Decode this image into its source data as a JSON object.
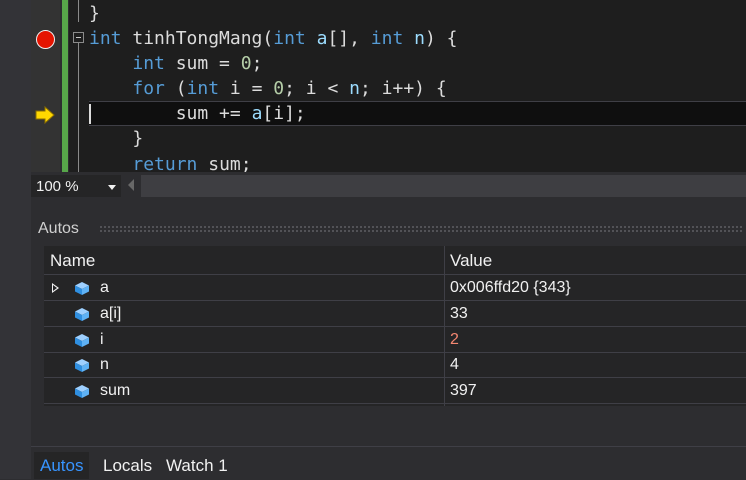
{
  "editor": {
    "lines": [
      {
        "tokens": [
          [
            "plain",
            "}"
          ]
        ]
      },
      {
        "tokens": [
          [
            "kw",
            "int"
          ],
          [
            "fn",
            " tinhTongMang("
          ],
          [
            "kw",
            "int"
          ],
          [
            "param",
            " a"
          ],
          [
            "plain",
            "[], "
          ],
          [
            "kw",
            "int"
          ],
          [
            "param",
            " n"
          ],
          [
            "plain",
            ") {"
          ]
        ]
      },
      {
        "tokens": [
          [
            "plain",
            "    "
          ],
          [
            "kw",
            "int"
          ],
          [
            "plain",
            " sum = "
          ],
          [
            "num",
            "0"
          ],
          [
            "plain",
            ";"
          ]
        ]
      },
      {
        "tokens": [
          [
            "plain",
            "    "
          ],
          [
            "kw",
            "for"
          ],
          [
            "plain",
            " ("
          ],
          [
            "kw",
            "int"
          ],
          [
            "plain",
            " i = "
          ],
          [
            "num",
            "0"
          ],
          [
            "plain",
            "; i < "
          ],
          [
            "param",
            "n"
          ],
          [
            "plain",
            "; i++) {"
          ]
        ]
      },
      {
        "tokens": [
          [
            "plain",
            "        sum += "
          ],
          [
            "param",
            "a"
          ],
          [
            "plain",
            "[i];"
          ]
        ]
      },
      {
        "tokens": [
          [
            "plain",
            "    }"
          ]
        ]
      },
      {
        "tokens": [
          [
            "plain",
            "    "
          ],
          [
            "kw",
            "return"
          ],
          [
            "plain",
            " sum;"
          ]
        ]
      }
    ],
    "colors": {
      "keyword": "#569cd6",
      "param": "#9cdcfe",
      "number": "#b5cea8",
      "text": "#dcdcdc"
    }
  },
  "zoom": {
    "value": "100 %"
  },
  "autos": {
    "title": "Autos",
    "columns": {
      "name": "Name",
      "value": "Value"
    },
    "rows": [
      {
        "name": "a",
        "value": "0x006ffd20 {343}",
        "expandable": true,
        "changed": false
      },
      {
        "name": "a[i]",
        "value": "33",
        "expandable": false,
        "changed": false
      },
      {
        "name": "i",
        "value": "2",
        "expandable": false,
        "changed": true
      },
      {
        "name": "n",
        "value": "4",
        "expandable": false,
        "changed": false
      },
      {
        "name": "sum",
        "value": "397",
        "expandable": false,
        "changed": false
      }
    ]
  },
  "tabs": [
    {
      "label": "Autos",
      "active": true
    },
    {
      "label": "Locals",
      "active": false
    },
    {
      "label": "Watch 1",
      "active": false
    }
  ]
}
